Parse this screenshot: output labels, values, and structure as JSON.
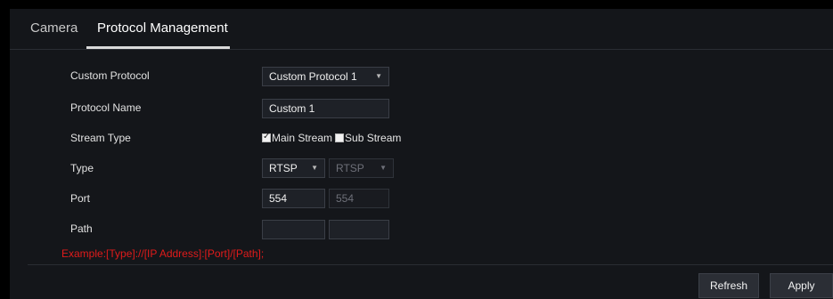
{
  "tabs": [
    {
      "label": "Camera",
      "active": false
    },
    {
      "label": "Protocol Management",
      "active": true
    }
  ],
  "form": {
    "custom_protocol": {
      "label": "Custom Protocol",
      "value": "Custom Protocol 1"
    },
    "protocol_name": {
      "label": "Protocol Name",
      "value": "Custom 1"
    },
    "stream_type": {
      "label": "Stream Type",
      "main": {
        "label": "Main Stream",
        "checked": true
      },
      "sub": {
        "label": "Sub Stream",
        "checked": false
      }
    },
    "type": {
      "label": "Type",
      "main_value": "RTSP",
      "sub_value": "RTSP"
    },
    "port": {
      "label": "Port",
      "main_value": "554",
      "sub_value": "554"
    },
    "path": {
      "label": "Path",
      "main_value": "",
      "sub_value": ""
    },
    "example": "Example:[Type]://[IP Address]:[Port]/[Path];"
  },
  "buttons": {
    "refresh": "Refresh",
    "apply": "Apply"
  },
  "colors": {
    "background": "#14161a",
    "error_text": "#e01b1b",
    "active_tab": "#ffffff"
  }
}
